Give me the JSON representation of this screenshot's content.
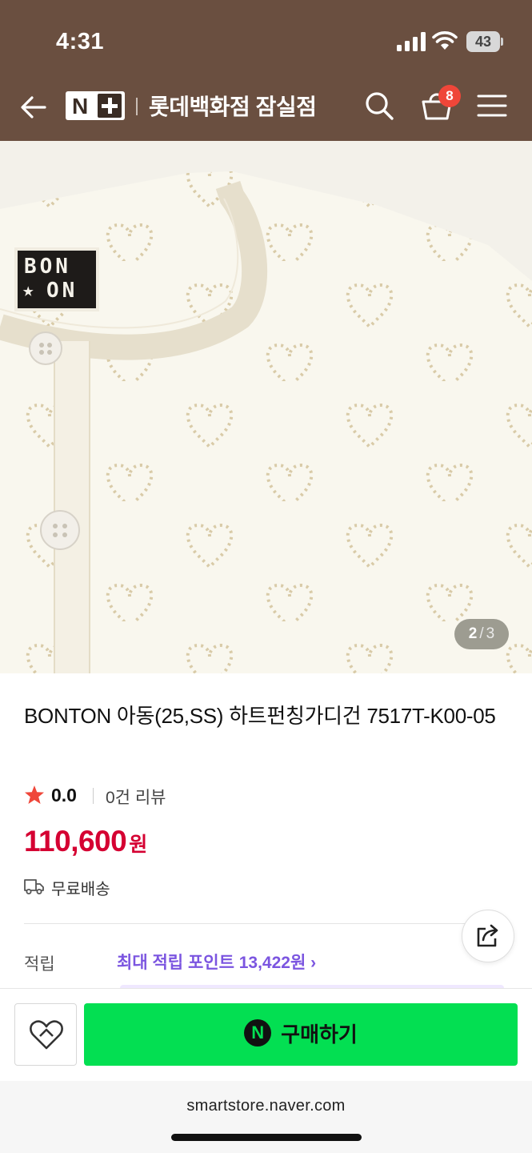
{
  "status_bar": {
    "time": "4:31",
    "battery": "43"
  },
  "header": {
    "logo": "N+",
    "store_name": "롯데백화점 잠실점",
    "cart_count": "8",
    "background_color": "#6a4f40"
  },
  "image": {
    "brand_tag_lines": [
      "BON",
      "ON"
    ],
    "pager_current": "2",
    "pager_separator": "/",
    "pager_total": "3"
  },
  "product": {
    "title": "BONTON 아동(25,SS) 하트펀칭가디건 7517T-K00-05",
    "rating": "0.0",
    "review_count": "0건 리뷰",
    "price": "110,600",
    "price_unit": "원",
    "price_color": "#d50032",
    "shipping": "무료배송"
  },
  "points": {
    "label": "적립",
    "link": "최대 적립 포인트 13,422원 ›",
    "color": "#7b55e0"
  },
  "bottom_bar": {
    "buy_label": "구매하기",
    "npay_glyph": "N",
    "buy_color": "#03df52"
  },
  "browser": {
    "url": "smartstore.naver.com"
  },
  "icons": [
    "back-arrow-icon",
    "search-icon",
    "cart-icon",
    "menu-icon",
    "star-icon",
    "truck-icon",
    "share-icon",
    "heart-icon",
    "npay-icon"
  ]
}
